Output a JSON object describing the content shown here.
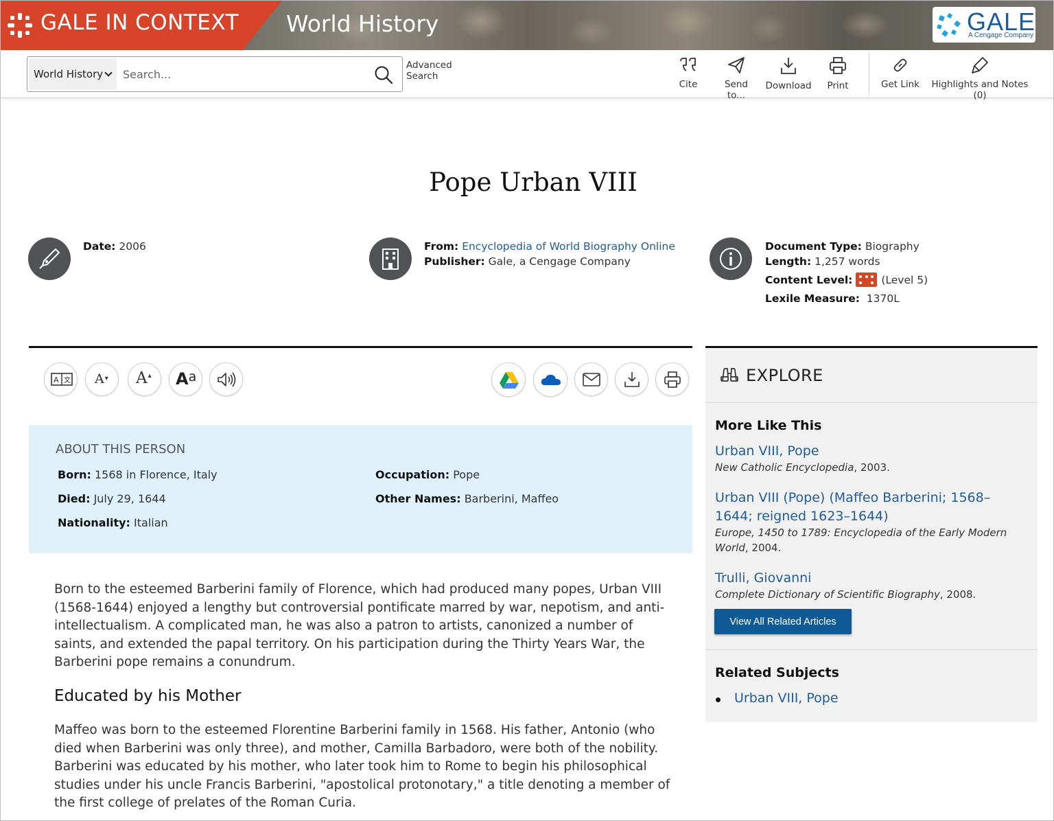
{
  "header": {
    "brand": "GALE IN CONTEXT",
    "product": "World History",
    "logo_word": "GALE",
    "logo_sub": "A Cengage Company",
    "brand_color": "#d8442a"
  },
  "toolbar": {
    "scope": "World History",
    "search_placeholder": "Search...",
    "advanced_line1": "Advanced",
    "advanced_line2": "Search",
    "cite": "Cite",
    "send": "Send to...",
    "download": "Download",
    "print": "Print",
    "get_link": "Get Link",
    "highlights": "Highlights and Notes (0)"
  },
  "document": {
    "title": "Pope Urban VIII",
    "date_label": "Date:",
    "date": "2006",
    "from_label": "From:",
    "from": "Encyclopedia of World Biography Online",
    "publisher_label": "Publisher:",
    "publisher": "Gale, a Cengage Company",
    "doc_type_label": "Document Type:",
    "doc_type": "Biography",
    "length_label": "Length:",
    "length": "1,257 words",
    "content_level_label": "Content Level:",
    "content_level": "(Level 5)",
    "content_level_value": 5,
    "lexile_label": "Lexile Measure:",
    "lexile": "1370L"
  },
  "reader_tools": [
    "translate-icon",
    "decrease-font-icon",
    "increase-font-icon",
    "font-style-icon",
    "listen-icon",
    "google-drive-icon",
    "onedrive-icon",
    "email-icon",
    "download-icon",
    "print-icon"
  ],
  "about": {
    "heading": "ABOUT THIS PERSON",
    "born_label": "Born:",
    "born": "1568 in Florence, Italy",
    "died_label": "Died:",
    "died": "July 29, 1644",
    "nationality_label": "Nationality:",
    "nationality": "Italian",
    "occupation_label": "Occupation:",
    "occupation": "Pope",
    "other_names_label": "Other Names:",
    "other_names": "Barberini, Maffeo"
  },
  "article": {
    "intro": "Born to the esteemed Barberini family of Florence, which had produced many popes, Urban VIII (1568-1644) enjoyed a lengthy but controversial pontificate marred by war, nepotism, and anti-intellectualism. A complicated man, he was also a patron to artists, canonized a number of saints, and extended the papal territory. On his participation during the Thirty Years War, the Barberini pope remains a conundrum.",
    "section_heading": "Educated by his Mother",
    "section_para": "Maffeo was born to the esteemed Florentine Barberini family in 1568. His father, Antonio (who died when Barberini was only three), and mother, Camilla Barbadoro, were both of the nobility. Barberini was educated by his mother, who later took him to Rome to begin his philosophical studies under his uncle Francis Barberini, \"apostolical protonotary,\" a title denoting a member of the first college of prelates of the Roman Curia."
  },
  "explore": {
    "title": "EXPLORE",
    "more_like_this": "More Like This",
    "items": [
      {
        "title": "Urban VIII, Pope",
        "source": "New Catholic Encyclopedia",
        "rest": ", 2003."
      },
      {
        "title": "Urban VIII (Pope) (Maffeo Barberini; 1568–1644; reigned 1623–1644)",
        "source": "Europe, 1450 to 1789: Encyclopedia of the Early Modern World",
        "rest": ", 2004."
      },
      {
        "title": "Trulli, Giovanni",
        "source": "Complete Dictionary of Scientific Biography",
        "rest": ", 2008."
      }
    ],
    "view_all": "View All Related Articles",
    "related_subjects": "Related Subjects",
    "subjects": [
      "Urban VIII, Pope"
    ]
  }
}
